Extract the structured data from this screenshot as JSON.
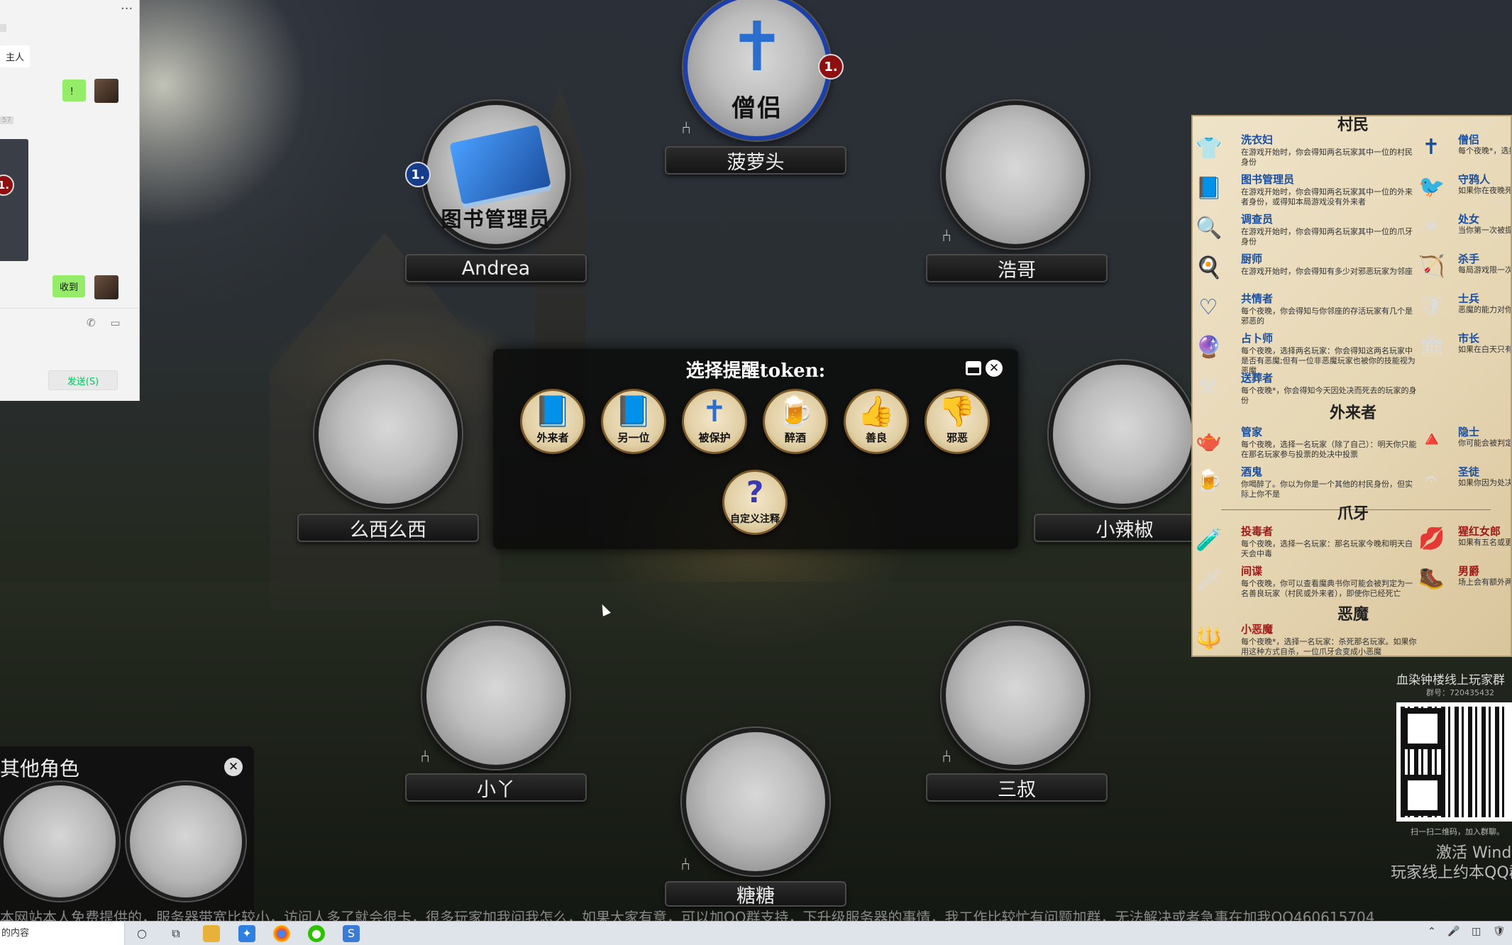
{
  "chat": {
    "more": "···",
    "msg_left": "主人",
    "bubble1": "！",
    "ts1": "57",
    "thumb_badge": "1.",
    "bubble2": "收到",
    "tool_icons": "✆ ▭",
    "send_label": "发送(S)"
  },
  "seats": {
    "top": {
      "role": "僧侣",
      "name": "菠萝头",
      "badge": "1."
    },
    "topleft": {
      "role": "图书管理员",
      "name": "Andrea",
      "badge": "1."
    },
    "topright": {
      "name": "浩哥"
    },
    "left": {
      "name": "么西么西"
    },
    "right": {
      "name": "小辣椒"
    },
    "bottomleft": {
      "name": "小丫"
    },
    "bottomright": {
      "name": "三叔"
    },
    "bottom": {
      "name": "糖糖"
    }
  },
  "modal": {
    "title": "选择提醒token:",
    "reminders": [
      {
        "label": "外来者",
        "icon": "📘"
      },
      {
        "label": "另一位",
        "icon": "📘"
      },
      {
        "label": "被保护",
        "icon": "✝"
      },
      {
        "label": "醉酒",
        "icon": "🍺"
      },
      {
        "label": "善良",
        "icon": "👍"
      },
      {
        "label": "邪恶",
        "icon": "👎"
      },
      {
        "label": "自定义注释",
        "icon": "?"
      }
    ]
  },
  "sheet": {
    "sections": {
      "townsfolk": "村民",
      "outsiders": "外来者",
      "minions": "爪牙",
      "demons": "恶魔"
    },
    "left_roles": [
      {
        "name": "洗衣妇",
        "desc": "在游戏开始时，你会得知两名玩家其中一位的村民身份",
        "icon": "👕"
      },
      {
        "name": "图书管理员",
        "desc": "在游戏开始时，你会得知两名玩家其中一位的外来者身份，或得知本局游戏没有外来者",
        "icon": "📘"
      },
      {
        "name": "调查员",
        "desc": "在游戏开始时，你会得知两名玩家其中一位的爪牙身份",
        "icon": "🔍"
      },
      {
        "name": "厨师",
        "desc": "在游戏开始时，你会得知有多少对邪恶玩家为邻座",
        "icon": "🍳"
      },
      {
        "name": "共情者",
        "desc": "每个夜晚，你会得知与你邻座的存活玩家有几个是邪恶的",
        "icon": "♡"
      },
      {
        "name": "占卜师",
        "desc": "每个夜晚，选择两名玩家：你会得知这两名玩家中是否有恶魔;但有一位非恶魔玩家也被你的技能视为恶魔",
        "icon": "🔮"
      },
      {
        "name": "送葬者",
        "desc": "每个夜晚*，你会得知今天因处决而死去的玩家的身份",
        "icon": "⚒"
      },
      {
        "name": "管家",
        "desc": "每个夜晚，选择一名玩家（除了自己）：明天你只能在那名玩家参与投票的处决中投票",
        "icon": "🫖"
      },
      {
        "name": "酒鬼",
        "desc": "你喝醉了。你以为你是一个其他的村民身份，但实际上你不是",
        "icon": "🍺"
      },
      {
        "name": "投毒者",
        "desc": "每个夜晚，选择一名玩家：那名玩家今晚和明天白天会中毒",
        "icon": "🧪"
      },
      {
        "name": "间谍",
        "desc": "每个夜晚，你可以查看魔典书你可能会被判定为一名善良玩家（村民或外来者），即使你已经死亡",
        "icon": "🗡"
      },
      {
        "name": "小恶魔",
        "desc": "每个夜晚*，选择一名玩家：杀死那名玩家。如果你用这种方式自杀，一位爪牙会变成小恶魔",
        "icon": "🔱"
      }
    ],
    "right_roles": [
      {
        "name": "僧侣",
        "desc": "每个夜晚*，选择",
        "icon": "✝"
      },
      {
        "name": "守鸦人",
        "desc": "如果你在夜晚死",
        "icon": "🐦"
      },
      {
        "name": "处女",
        "desc": "当你第一次被提",
        "icon": "⚭"
      },
      {
        "name": "杀手",
        "desc": "每局游戏限一次",
        "icon": "🏹"
      },
      {
        "name": "士兵",
        "desc": "恶魔的能力对你",
        "icon": "🛡"
      },
      {
        "name": "市长",
        "desc": "如果在白天只有",
        "icon": "🏛"
      },
      {
        "name": "隐士",
        "desc": "你可能会被判定",
        "icon": "🔺"
      },
      {
        "name": "圣徒",
        "desc": "如果你因为处决",
        "icon": "𝄐"
      },
      {
        "name": "猩红女郎",
        "desc": "如果有五名或更",
        "icon": "💋"
      },
      {
        "name": "男爵",
        "desc": "场上会有额外两",
        "icon": "🥾"
      }
    ]
  },
  "qq": {
    "title": "血染钟楼线上玩家群",
    "number": "群号：720435432",
    "caption": "扫一扫二维码，加入群聊。",
    "activate": "激活 Windo",
    "promo": "玩家线上约本QQ群"
  },
  "others": {
    "title": "其他角色",
    "close": "✕"
  },
  "ticker": "本网站本人免费提供的，服务器带宽比较小，访问人多了就会很卡，很多玩家加我问我怎么，如果大家有意，可以加QQ群支持，下升级服务器的事情，我工作比较忙有问题加群，无法解决或者急事在加我QQ460615704",
  "taskbar": {
    "search_text": "的内容",
    "tray": "⌃ 🎤 ◫ 🛡 ▭ 🔊"
  },
  "colors": {
    "wechat_green": "#95ec69",
    "send_green": "#07c160",
    "badge_red": "#8c1010",
    "badge_blue": "#183c8c"
  }
}
